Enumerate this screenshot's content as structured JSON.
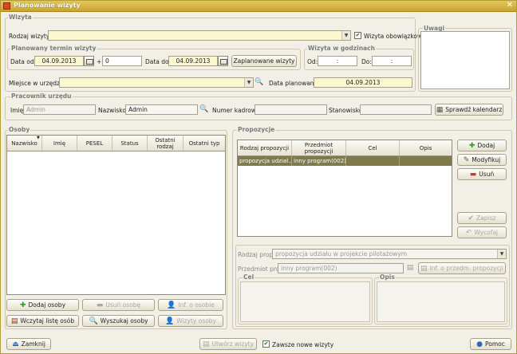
{
  "window": {
    "title": "Planowanie wizyty"
  },
  "wizyta": {
    "section_label": "Wizyta",
    "rodzaj_label": "Rodzaj wizyty:",
    "rodzaj_value": "",
    "obowiazkowa_label": "Wizyta obowiązkowa",
    "obowiazkowa_checked": true
  },
  "termin": {
    "section_label": "Planowany termin wizyty",
    "data_od_label": "Data od:",
    "data_od_value": "04.09.2013",
    "plus_label": "+",
    "plus_value": "0",
    "data_do_label": "Data do:",
    "data_do_value": "04.09.2013",
    "zaplanowane_button": "Zaplanowane wizyty"
  },
  "godziny": {
    "section_label": "Wizyta w godzinach",
    "od_label": "Od:",
    "od_value": ":",
    "do_label": "Do:",
    "do_value": ":"
  },
  "uwagi": {
    "section_label": "Uwagi"
  },
  "miejsce": {
    "label": "Miejsce w urzędzie:",
    "value": "",
    "data_planowania_label": "Data planowania:",
    "data_planowania_value": "04.09.2013"
  },
  "pracownik": {
    "section_label": "Pracownik urzędu",
    "imie_label": "Imię:",
    "imie_value": "Admin",
    "nazwisko_label": "Nazwisko:",
    "nazwisko_value": "Admin",
    "numer_label": "Numer kadrowy:",
    "numer_value": "",
    "stanowisko_label": "Stanowisko:",
    "stanowisko_value": "",
    "kalendarz_button": "Sprawdź kalendarz"
  },
  "osoby": {
    "section_label": "Osoby",
    "columns": [
      "Nazwisko",
      "Imię",
      "PESEL",
      "Status",
      "Ostatni rodzaj",
      "Ostatni typ"
    ],
    "buttons": {
      "dodaj": "Dodaj osoby",
      "usun": "Usuń osobę",
      "inf": "Inf. o osobie",
      "wczytaj": "Wczytaj listę osób",
      "wyszukaj": "Wyszukaj osoby",
      "wizyty": "Wizyty osoby"
    }
  },
  "propozycje": {
    "section_label": "Propozycje",
    "columns": [
      "Rodzaj propozycji",
      "Przedmiot propozycji",
      "Cel",
      "Opis"
    ],
    "rows": [
      {
        "rodzaj": "propozycja udział...",
        "przedmiot": "inny program(002)",
        "cel": "",
        "opis": ""
      }
    ],
    "buttons": {
      "dodaj": "Dodaj",
      "modyfikuj": "Modyfikuj",
      "usun": "Usuń",
      "zapisz": "Zapisz",
      "wycofaj": "Wycofaj"
    },
    "rodzaj_prop_label": "Rodzaj prop.",
    "rodzaj_prop_value": "propozycja udziału w projekcie pilotażowym",
    "przedmiot_prop_label": "Przedmiot prop.",
    "przedmiot_prop_value": "inny program(002)",
    "inf_button": "Inf. o przedm. propozycji",
    "cel_label": "Cel",
    "opis_label": "Opis"
  },
  "bottom": {
    "zamknij": "Zamknij",
    "utworz": "Utwórz wizyty",
    "zawsze_label": "Zawsze nowe wizyty",
    "zawsze_checked": true,
    "pomoc": "Pomoc"
  }
}
